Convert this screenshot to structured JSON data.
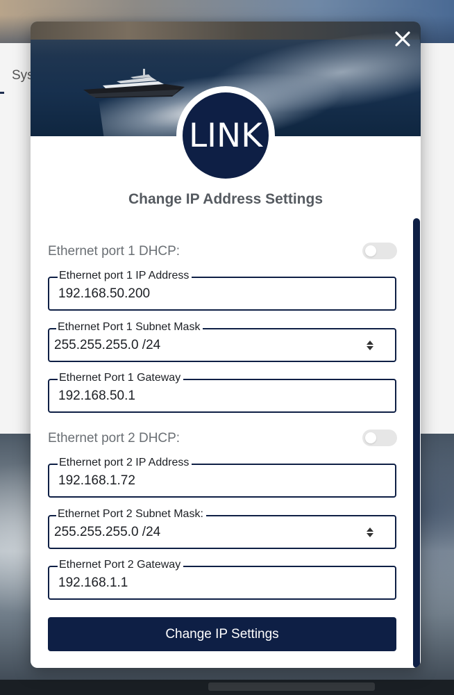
{
  "background": {
    "tab_label": "Sys"
  },
  "modal": {
    "logo_text": "LINK",
    "title": "Change IP Address Settings",
    "port1": {
      "dhcp_label": "Ethernet port 1 DHCP:",
      "dhcp_enabled": false,
      "ip_label": "Ethernet port 1 IP Address",
      "ip_value": "192.168.50.200",
      "subnet_label": "Ethernet Port 1 Subnet Mask",
      "subnet_value": "255.255.255.0 /24",
      "gateway_label": "Ethernet Port 1 Gateway",
      "gateway_value": "192.168.50.1"
    },
    "port2": {
      "dhcp_label": "Ethernet port 2 DHCP:",
      "dhcp_enabled": false,
      "ip_label": "Ethernet port 2 IP Address",
      "ip_value": "192.168.1.72",
      "subnet_label": "Ethernet Port 2 Subnet Mask:",
      "subnet_value": "255.255.255.0 /24",
      "gateway_label": "Ethernet Port 2 Gateway",
      "gateway_value": "192.168.1.1"
    },
    "submit_label": "Change IP Settings"
  },
  "colors": {
    "brand_navy": "#0e1f45",
    "toggle_off": "#e6e6e6",
    "label_gray": "#6a6f74"
  },
  "icons": {
    "close": "close-icon",
    "select_arrows": "sort-arrows-icon"
  }
}
